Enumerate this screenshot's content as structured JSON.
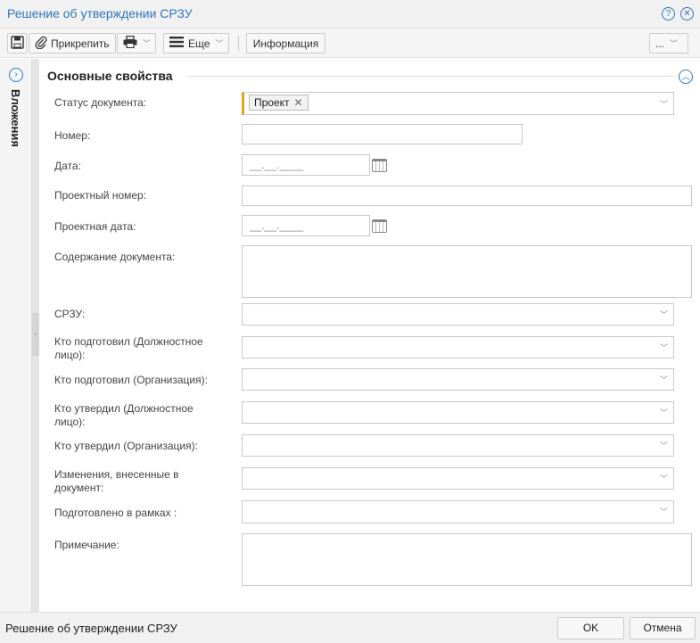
{
  "window": {
    "title": "Решение об утверждении СРЗУ",
    "icons": [
      "help-icon",
      "close-icon"
    ]
  },
  "toolbar": {
    "save_icon": "floppy-icon",
    "attach_label": "Прикрепить",
    "print_icon": "printer-icon",
    "more_label": "Еще",
    "info_label": "Информация",
    "ellipsis_label": "..."
  },
  "side_panel": {
    "title": "Вложения"
  },
  "section": {
    "title": "Основные свойства"
  },
  "fields": {
    "status": {
      "label": "Статус документа:",
      "tag": "Проект"
    },
    "number": {
      "label": "Номер:",
      "value": ""
    },
    "date": {
      "label": "Дата:",
      "value": "__.__.____"
    },
    "project_number": {
      "label": "Проектный номер:",
      "value": ""
    },
    "project_date": {
      "label": "Проектная дата:",
      "value": "__.__.____"
    },
    "content": {
      "label": "Содержание документа:",
      "value": ""
    },
    "srzu": {
      "label": "СРЗУ:",
      "value": ""
    },
    "prepared_person": {
      "label": "Кто подготовил (Должностное лицо):",
      "value": ""
    },
    "prepared_org": {
      "label": "Кто подготовил (Организация):",
      "value": ""
    },
    "approved_person": {
      "label": "Кто утвердил (Должностное лицо):",
      "value": ""
    },
    "approved_org": {
      "label": "Кто утвердил (Организация):",
      "value": ""
    },
    "changes": {
      "label": "Изменения, внесенные в документ:",
      "value": ""
    },
    "prepared_within": {
      "label": "Подготовлено в рамках :",
      "value": ""
    },
    "note": {
      "label": "Примечание:",
      "value": ""
    }
  },
  "footer": {
    "text": "Решение об утверждении СРЗУ",
    "ok_label": "OK",
    "cancel_label": "Отмена"
  },
  "colors": {
    "accent": "#2d77b9",
    "required_marker": "#e6a020"
  }
}
